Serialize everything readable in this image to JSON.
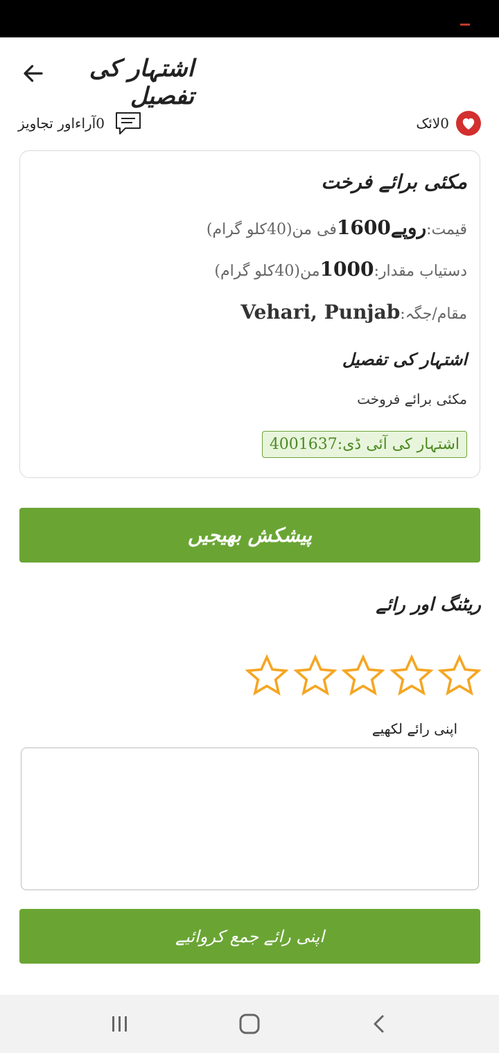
{
  "header": {
    "title": "اشتہار کی تفصیل"
  },
  "meta": {
    "likes": "0لائک",
    "comments": "0آراءاور تجاویز"
  },
  "ad": {
    "title": "مکئی برائے فرخت",
    "price_label": "قیمت:",
    "price_value": "روپے1600",
    "price_unit": "فی من(40کلو گرام)",
    "qty_label": "دستیاب مقدار:",
    "qty_value": "1000",
    "qty_unit": "من(40کلو گرام)",
    "location_label": "مقام/جگہ:",
    "location_value": "Vehari, Punjab",
    "desc_heading": "اشتہار کی تفصیل",
    "desc_text": "مکئی برائے فروخت",
    "ad_id": "اشتہار کی آئی ڈی:4001637"
  },
  "actions": {
    "send_offer": "پیشکش بھیجیں"
  },
  "rating": {
    "title": "ریٹنگ اور رائے",
    "max_stars": 5,
    "value": 0,
    "review_label": "اپنی رائے لکھیے",
    "review_value": "",
    "submit": "اپنی رائے جمع کروائیے"
  },
  "colors": {
    "accent": "#6aa534",
    "heart": "#d32f2f",
    "star": "#f5a623",
    "badge_bg": "#e8f5dc"
  }
}
